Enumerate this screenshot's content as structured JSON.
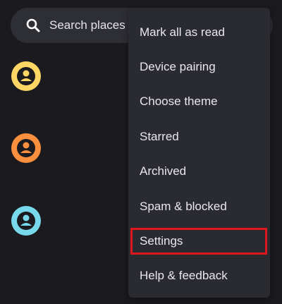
{
  "search": {
    "placeholder": "Search places",
    "icon": "search-icon"
  },
  "avatars": [
    {
      "color": "#fdd663",
      "icon": "person-icon"
    },
    {
      "color": "#fa903e",
      "icon": "person-icon"
    },
    {
      "color": "#78d9ec",
      "icon": "person-icon"
    }
  ],
  "menu": {
    "items": [
      {
        "label": "Mark all as read"
      },
      {
        "label": "Device pairing"
      },
      {
        "label": "Choose theme"
      },
      {
        "label": "Starred"
      },
      {
        "label": "Archived"
      },
      {
        "label": "Spam & blocked"
      },
      {
        "label": "Settings",
        "highlighted": true
      },
      {
        "label": "Help & feedback"
      }
    ]
  },
  "colors": {
    "background": "#1b1b1f",
    "search_bar": "#2e2f35",
    "menu_background": "#2a2b31",
    "menu_text": "#e7e7ed",
    "highlight": "#e0161e"
  }
}
